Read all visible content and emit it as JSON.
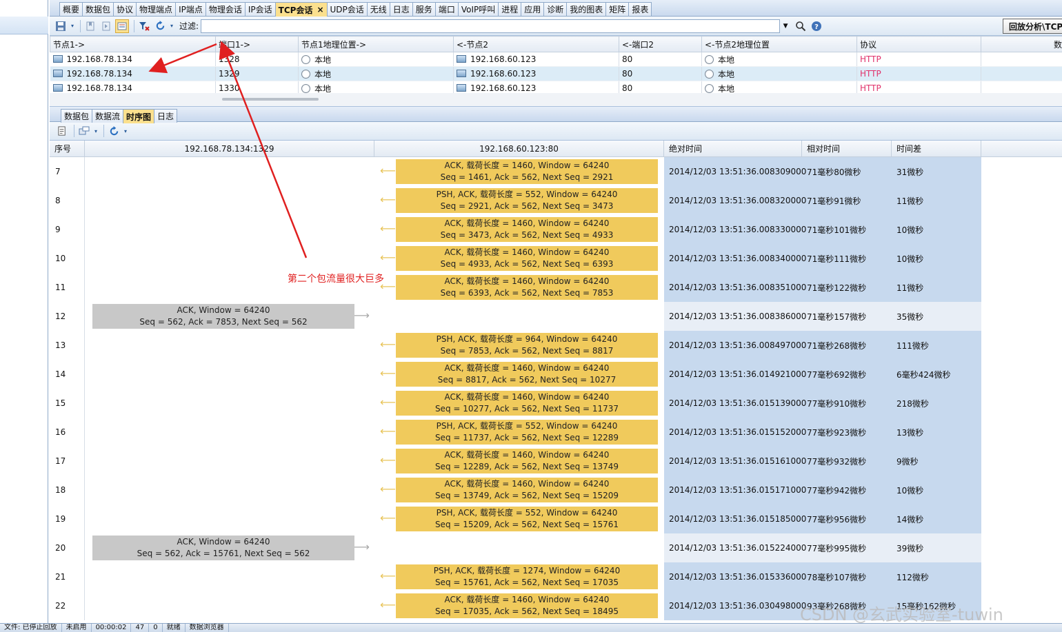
{
  "top_tabs": [
    {
      "label": "概要"
    },
    {
      "label": "数据包"
    },
    {
      "label": "协议"
    },
    {
      "label": "物理端点"
    },
    {
      "label": "IP端点"
    },
    {
      "label": "物理会话"
    },
    {
      "label": "IP会话"
    },
    {
      "label": "TCP会话",
      "active": true
    },
    {
      "label": "UDP会话"
    },
    {
      "label": "无线"
    },
    {
      "label": "日志"
    },
    {
      "label": "服务"
    },
    {
      "label": "端口"
    },
    {
      "label": "VoIP呼叫"
    },
    {
      "label": "进程"
    },
    {
      "label": "应用"
    },
    {
      "label": "诊断"
    },
    {
      "label": "我的图表"
    },
    {
      "label": "矩阵"
    },
    {
      "label": "报表"
    }
  ],
  "toolbar": {
    "filter_label": "过滤:",
    "filter_value": "",
    "replay_button": "回放分析\\TCP"
  },
  "sessions": {
    "columns": [
      "节点1->",
      "端口1->",
      "节点1地理位置->",
      "<-节点2",
      "<-端口2",
      "<-节点2地理位置",
      "协议",
      "数"
    ],
    "rows": [
      {
        "node1": "192.168.78.134",
        "port1": "1328",
        "geo1": "本地",
        "node2": "192.168.60.123",
        "port2": "80",
        "geo2": "本地",
        "proto": "HTTP"
      },
      {
        "node1": "192.168.78.134",
        "port1": "1329",
        "geo1": "本地",
        "node2": "192.168.60.123",
        "port2": "80",
        "geo2": "本地",
        "proto": "HTTP",
        "selected": true
      },
      {
        "node1": "192.168.78.134",
        "port1": "1330",
        "geo1": "本地",
        "node2": "192.168.60.123",
        "port2": "80",
        "geo2": "本地",
        "proto": "HTTP"
      }
    ]
  },
  "sub_tabs": [
    {
      "label": "数据包"
    },
    {
      "label": "数据流"
    },
    {
      "label": "时序图",
      "active": true
    },
    {
      "label": "日志"
    }
  ],
  "sequence": {
    "headers": {
      "num": "序号",
      "client": "192.168.78.134:1329",
      "server": "192.168.60.123:80",
      "abs": "绝对时间",
      "rel": "相对时间",
      "diff": "时间差"
    },
    "rows": [
      {
        "n": "7",
        "dir": "srv",
        "l1": "ACK, 载荷长度 = 1460, Window = 64240",
        "l2": "Seq = 1461, Ack = 562, Next Seq = 2921",
        "abs": "2014/12/03 13:51:36.008309000",
        "rel": "71毫秒80微秒",
        "diff": "31微秒"
      },
      {
        "n": "8",
        "dir": "srv",
        "l1": "PSH, ACK, 载荷长度 = 552, Window = 64240",
        "l2": "Seq = 2921, Ack = 562, Next Seq = 3473",
        "abs": "2014/12/03 13:51:36.008320000",
        "rel": "71毫秒91微秒",
        "diff": "11微秒"
      },
      {
        "n": "9",
        "dir": "srv",
        "l1": "ACK, 载荷长度 = 1460, Window = 64240",
        "l2": "Seq = 3473, Ack = 562, Next Seq = 4933",
        "abs": "2014/12/03 13:51:36.008330000",
        "rel": "71毫秒101微秒",
        "diff": "10微秒"
      },
      {
        "n": "10",
        "dir": "srv",
        "l1": "ACK, 载荷长度 = 1460, Window = 64240",
        "l2": "Seq = 4933, Ack = 562, Next Seq = 6393",
        "abs": "2014/12/03 13:51:36.008340000",
        "rel": "71毫秒111微秒",
        "diff": "10微秒"
      },
      {
        "n": "11",
        "dir": "srv",
        "l1": "ACK, 载荷长度 = 1460, Window = 64240",
        "l2": "Seq = 6393, Ack = 562, Next Seq = 7853",
        "abs": "2014/12/03 13:51:36.008351000",
        "rel": "71毫秒122微秒",
        "diff": "11微秒"
      },
      {
        "n": "12",
        "dir": "cli",
        "l1": "ACK, Window = 64240",
        "l2": "Seq = 562, Ack = 7853, Next Seq = 562",
        "abs": "2014/12/03 13:51:36.008386000",
        "rel": "71毫秒157微秒",
        "diff": "35微秒"
      },
      {
        "n": "13",
        "dir": "srv",
        "l1": "PSH, ACK, 载荷长度 = 964, Window = 64240",
        "l2": "Seq = 7853, Ack = 562, Next Seq = 8817",
        "abs": "2014/12/03 13:51:36.008497000",
        "rel": "71毫秒268微秒",
        "diff": "111微秒"
      },
      {
        "n": "14",
        "dir": "srv",
        "l1": "ACK, 载荷长度 = 1460, Window = 64240",
        "l2": "Seq = 8817, Ack = 562, Next Seq = 10277",
        "abs": "2014/12/03 13:51:36.014921000",
        "rel": "77毫秒692微秒",
        "diff": "6毫秒424微秒"
      },
      {
        "n": "15",
        "dir": "srv",
        "l1": "ACK, 载荷长度 = 1460, Window = 64240",
        "l2": "Seq = 10277, Ack = 562, Next Seq = 11737",
        "abs": "2014/12/03 13:51:36.015139000",
        "rel": "77毫秒910微秒",
        "diff": "218微秒"
      },
      {
        "n": "16",
        "dir": "srv",
        "l1": "PSH, ACK, 载荷长度 = 552, Window = 64240",
        "l2": "Seq = 11737, Ack = 562, Next Seq = 12289",
        "abs": "2014/12/03 13:51:36.015152000",
        "rel": "77毫秒923微秒",
        "diff": "13微秒"
      },
      {
        "n": "17",
        "dir": "srv",
        "l1": "ACK, 载荷长度 = 1460, Window = 64240",
        "l2": "Seq = 12289, Ack = 562, Next Seq = 13749",
        "abs": "2014/12/03 13:51:36.015161000",
        "rel": "77毫秒932微秒",
        "diff": "9微秒"
      },
      {
        "n": "18",
        "dir": "srv",
        "l1": "ACK, 载荷长度 = 1460, Window = 64240",
        "l2": "Seq = 13749, Ack = 562, Next Seq = 15209",
        "abs": "2014/12/03 13:51:36.015171000",
        "rel": "77毫秒942微秒",
        "diff": "10微秒"
      },
      {
        "n": "19",
        "dir": "srv",
        "l1": "PSH, ACK, 载荷长度 = 552, Window = 64240",
        "l2": "Seq = 15209, Ack = 562, Next Seq = 15761",
        "abs": "2014/12/03 13:51:36.015185000",
        "rel": "77毫秒956微秒",
        "diff": "14微秒"
      },
      {
        "n": "20",
        "dir": "cli",
        "l1": "ACK, Window = 64240",
        "l2": "Seq = 562, Ack = 15761, Next Seq = 562",
        "abs": "2014/12/03 13:51:36.015224000",
        "rel": "77毫秒995微秒",
        "diff": "39微秒"
      },
      {
        "n": "21",
        "dir": "srv",
        "l1": "PSH, ACK, 载荷长度 = 1274, Window = 64240",
        "l2": "Seq = 15761, Ack = 562, Next Seq = 17035",
        "abs": "2014/12/03 13:51:36.015336000",
        "rel": "78毫秒107微秒",
        "diff": "112微秒"
      },
      {
        "n": "22",
        "dir": "srv",
        "l1": "ACK, 载荷长度 = 1460, Window = 64240",
        "l2": "Seq = 17035, Ack = 562, Next Seq = 18495",
        "abs": "2014/12/03 13:51:36.030498000",
        "rel": "93毫秒268微秒",
        "diff": "15毫秒162微秒"
      }
    ]
  },
  "annotation": {
    "text": "第二个包流量很大巨多",
    "color": "#e02020"
  },
  "statusbar": {
    "items": [
      "文件: 已停止回放",
      "未启用",
      "00:00:02",
      "47",
      "0",
      "就绪",
      "数据浏览器"
    ]
  },
  "watermark": "CSDN @玄武实验室-tuwin",
  "colors": {
    "server_packet": "#f0ca5c",
    "client_packet": "#c8c8c8",
    "info_bg": "#c7d9ee",
    "active_tab": "#fbe08e",
    "http": "#e0306a"
  }
}
